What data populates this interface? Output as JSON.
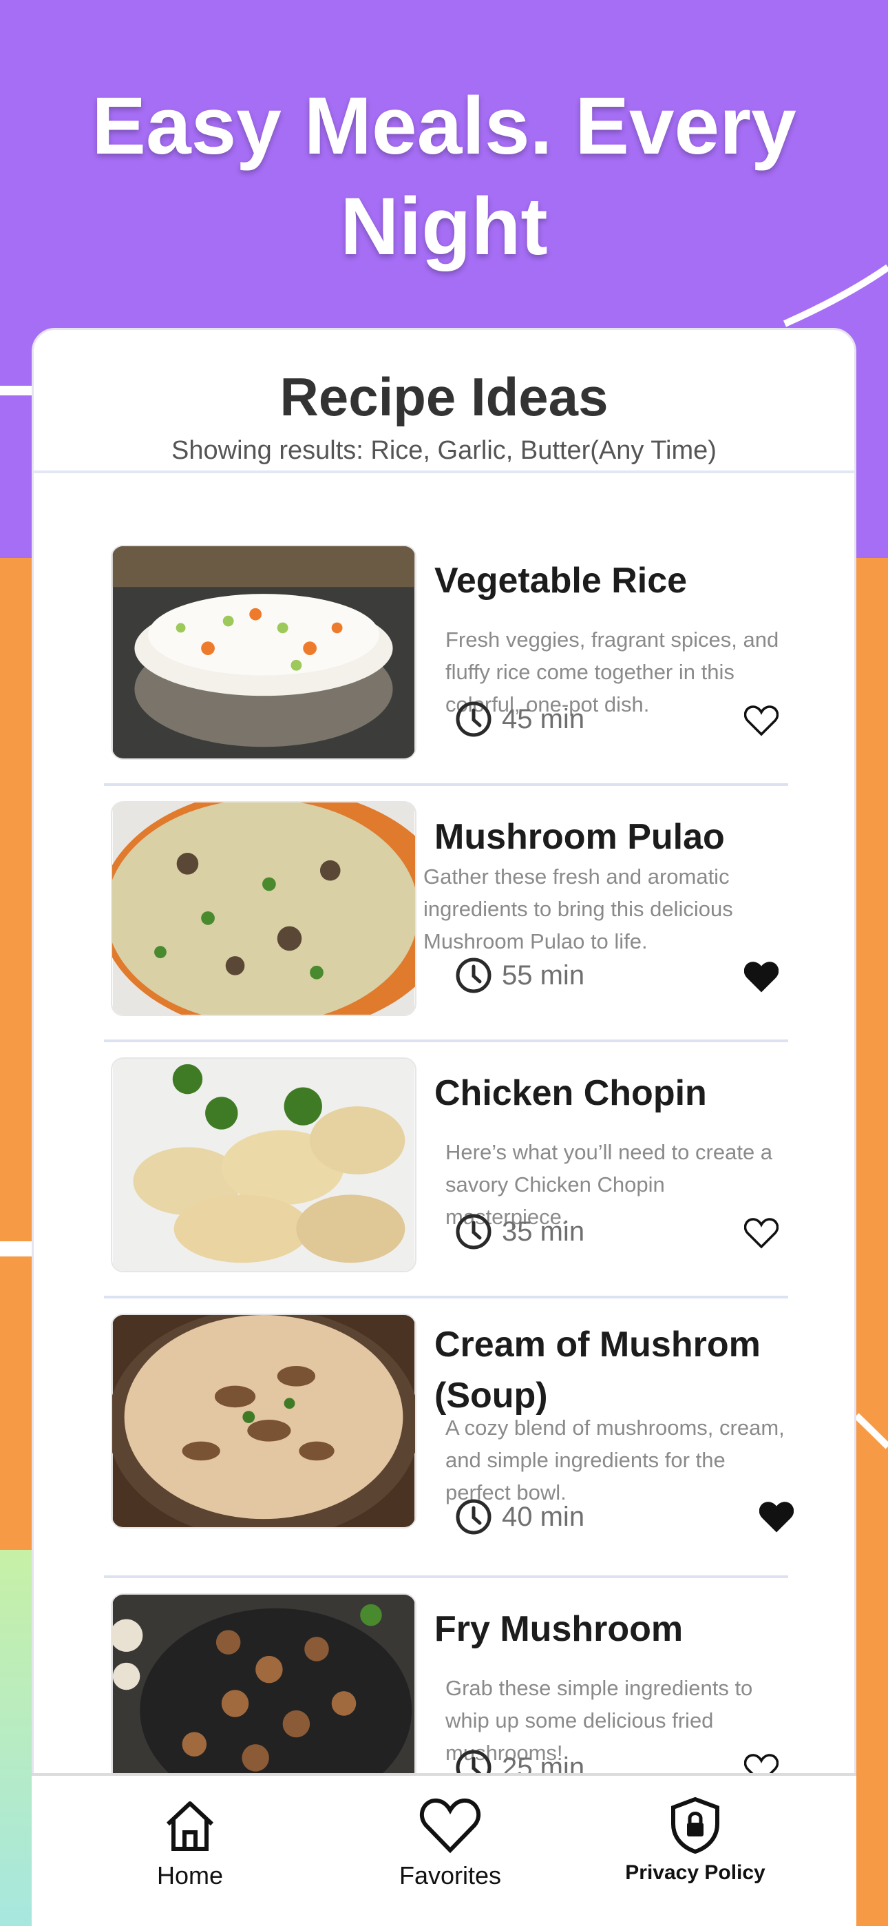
{
  "hero": {
    "title": "Easy Meals. Every Night"
  },
  "card": {
    "title": "Recipe Ideas",
    "subtitle": "Showing results: Rice, Garlic, Butter(Any Time)"
  },
  "recipes": [
    {
      "title": "Vegetable Rice",
      "description": "Fresh veggies, fragrant spices, and fluffy rice come together in this colorful, one-pot dish.",
      "time": "45 min",
      "favorite": false
    },
    {
      "title": "Mushroom Pulao",
      "description": "Gather these fresh and aromatic ingredients to bring this delicious Mushroom Pulao to life.",
      "time": "55 min",
      "favorite": true
    },
    {
      "title": "Chicken Chopin",
      "description": "Here’s what you’ll need to create a savory Chicken Chopin masterpiece.",
      "time": "35 min",
      "favorite": false
    },
    {
      "title": "Cream of Mushrom (Soup)",
      "description": "A cozy blend of mushrooms, cream, and simple ingredients for the perfect bowl.",
      "time": "40 min",
      "favorite": true
    },
    {
      "title": "Fry Mushroom",
      "description": "Grab these simple ingredients to whip up some delicious fried mushrooms!",
      "time": "25 min",
      "favorite": false
    }
  ],
  "nav": {
    "home": "Home",
    "favorites": "Favorites",
    "privacy": "Privacy Policy"
  },
  "colors": {
    "purple": "#a66ef5",
    "orange": "#f79a45"
  },
  "icons": [
    "clock-icon",
    "heart-icon",
    "home-icon",
    "shield-lock-icon"
  ]
}
